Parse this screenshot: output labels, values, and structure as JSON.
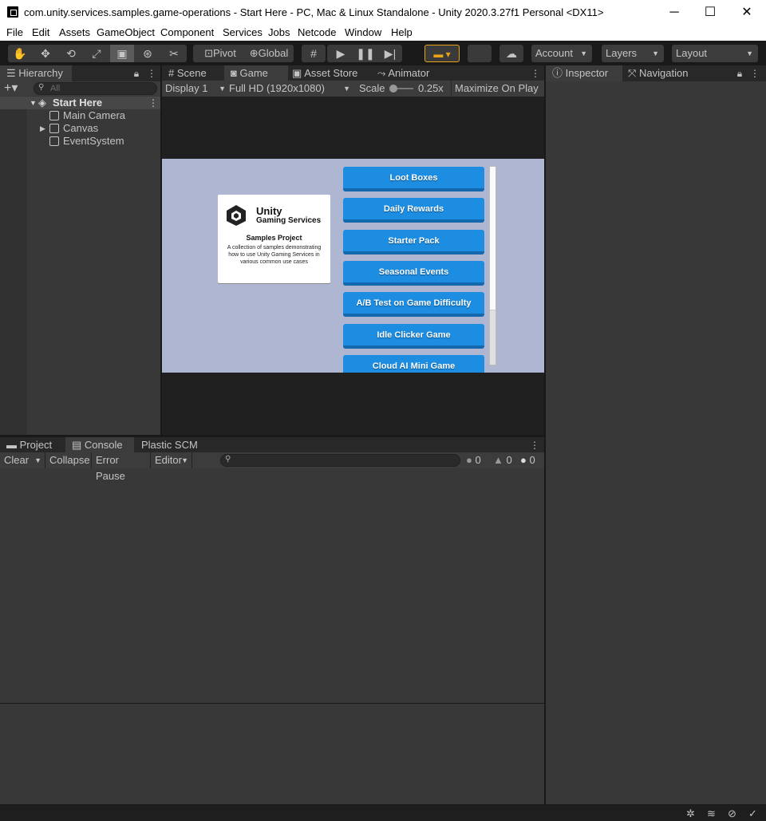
{
  "window": {
    "title": "com.unity.services.samples.game-operations - Start Here - PC, Mac & Linux Standalone - Unity 2020.3.27f1 Personal <DX11>",
    "minimize": "─",
    "maximize": "☐",
    "close": "✕"
  },
  "menu": [
    "File",
    "Edit",
    "Assets",
    "GameObject",
    "Component",
    "Services",
    "Jobs",
    "Netcode",
    "Window",
    "Help"
  ],
  "toolbar": {
    "pivot": "Pivot",
    "global": "Global",
    "account": "Account",
    "layers": "Layers",
    "layout": "Layout"
  },
  "hierarchy": {
    "tab": "Hierarchy",
    "search_placeholder": "All",
    "scene": "Start Here",
    "items": [
      "Main Camera",
      "Canvas",
      "EventSystem"
    ]
  },
  "center_tabs": {
    "scene": "Scene",
    "game": "Game",
    "asset_store": "Asset Store",
    "animator": "Animator"
  },
  "game_toolbar": {
    "display": "Display 1",
    "resolution": "Full HD (1920x1080)",
    "scale_label": "Scale",
    "scale_value": "0.25x",
    "maximize": "Maximize On Play"
  },
  "game_view": {
    "brand": "Unity",
    "brand_sub": "Gaming Services",
    "card_title": "Samples Project",
    "card_desc": "A collection of samples demonstrating how to use Unity Gaming Services in various common use cases",
    "buttons": [
      "Loot Boxes",
      "Daily Rewards",
      "Starter Pack",
      "Seasonal Events",
      "A/B Test on Game Difficulty",
      "Idle Clicker Game",
      "Cloud AI Mini Game"
    ]
  },
  "right_tabs": {
    "inspector": "Inspector",
    "navigation": "Navigation"
  },
  "bottom_tabs": {
    "project": "Project",
    "console": "Console",
    "plastic": "Plastic SCM"
  },
  "console": {
    "clear": "Clear",
    "collapse": "Collapse",
    "error_pause": "Error Pause",
    "editor": "Editor",
    "log_count": "0",
    "warn_count": "0",
    "error_count": "0"
  }
}
